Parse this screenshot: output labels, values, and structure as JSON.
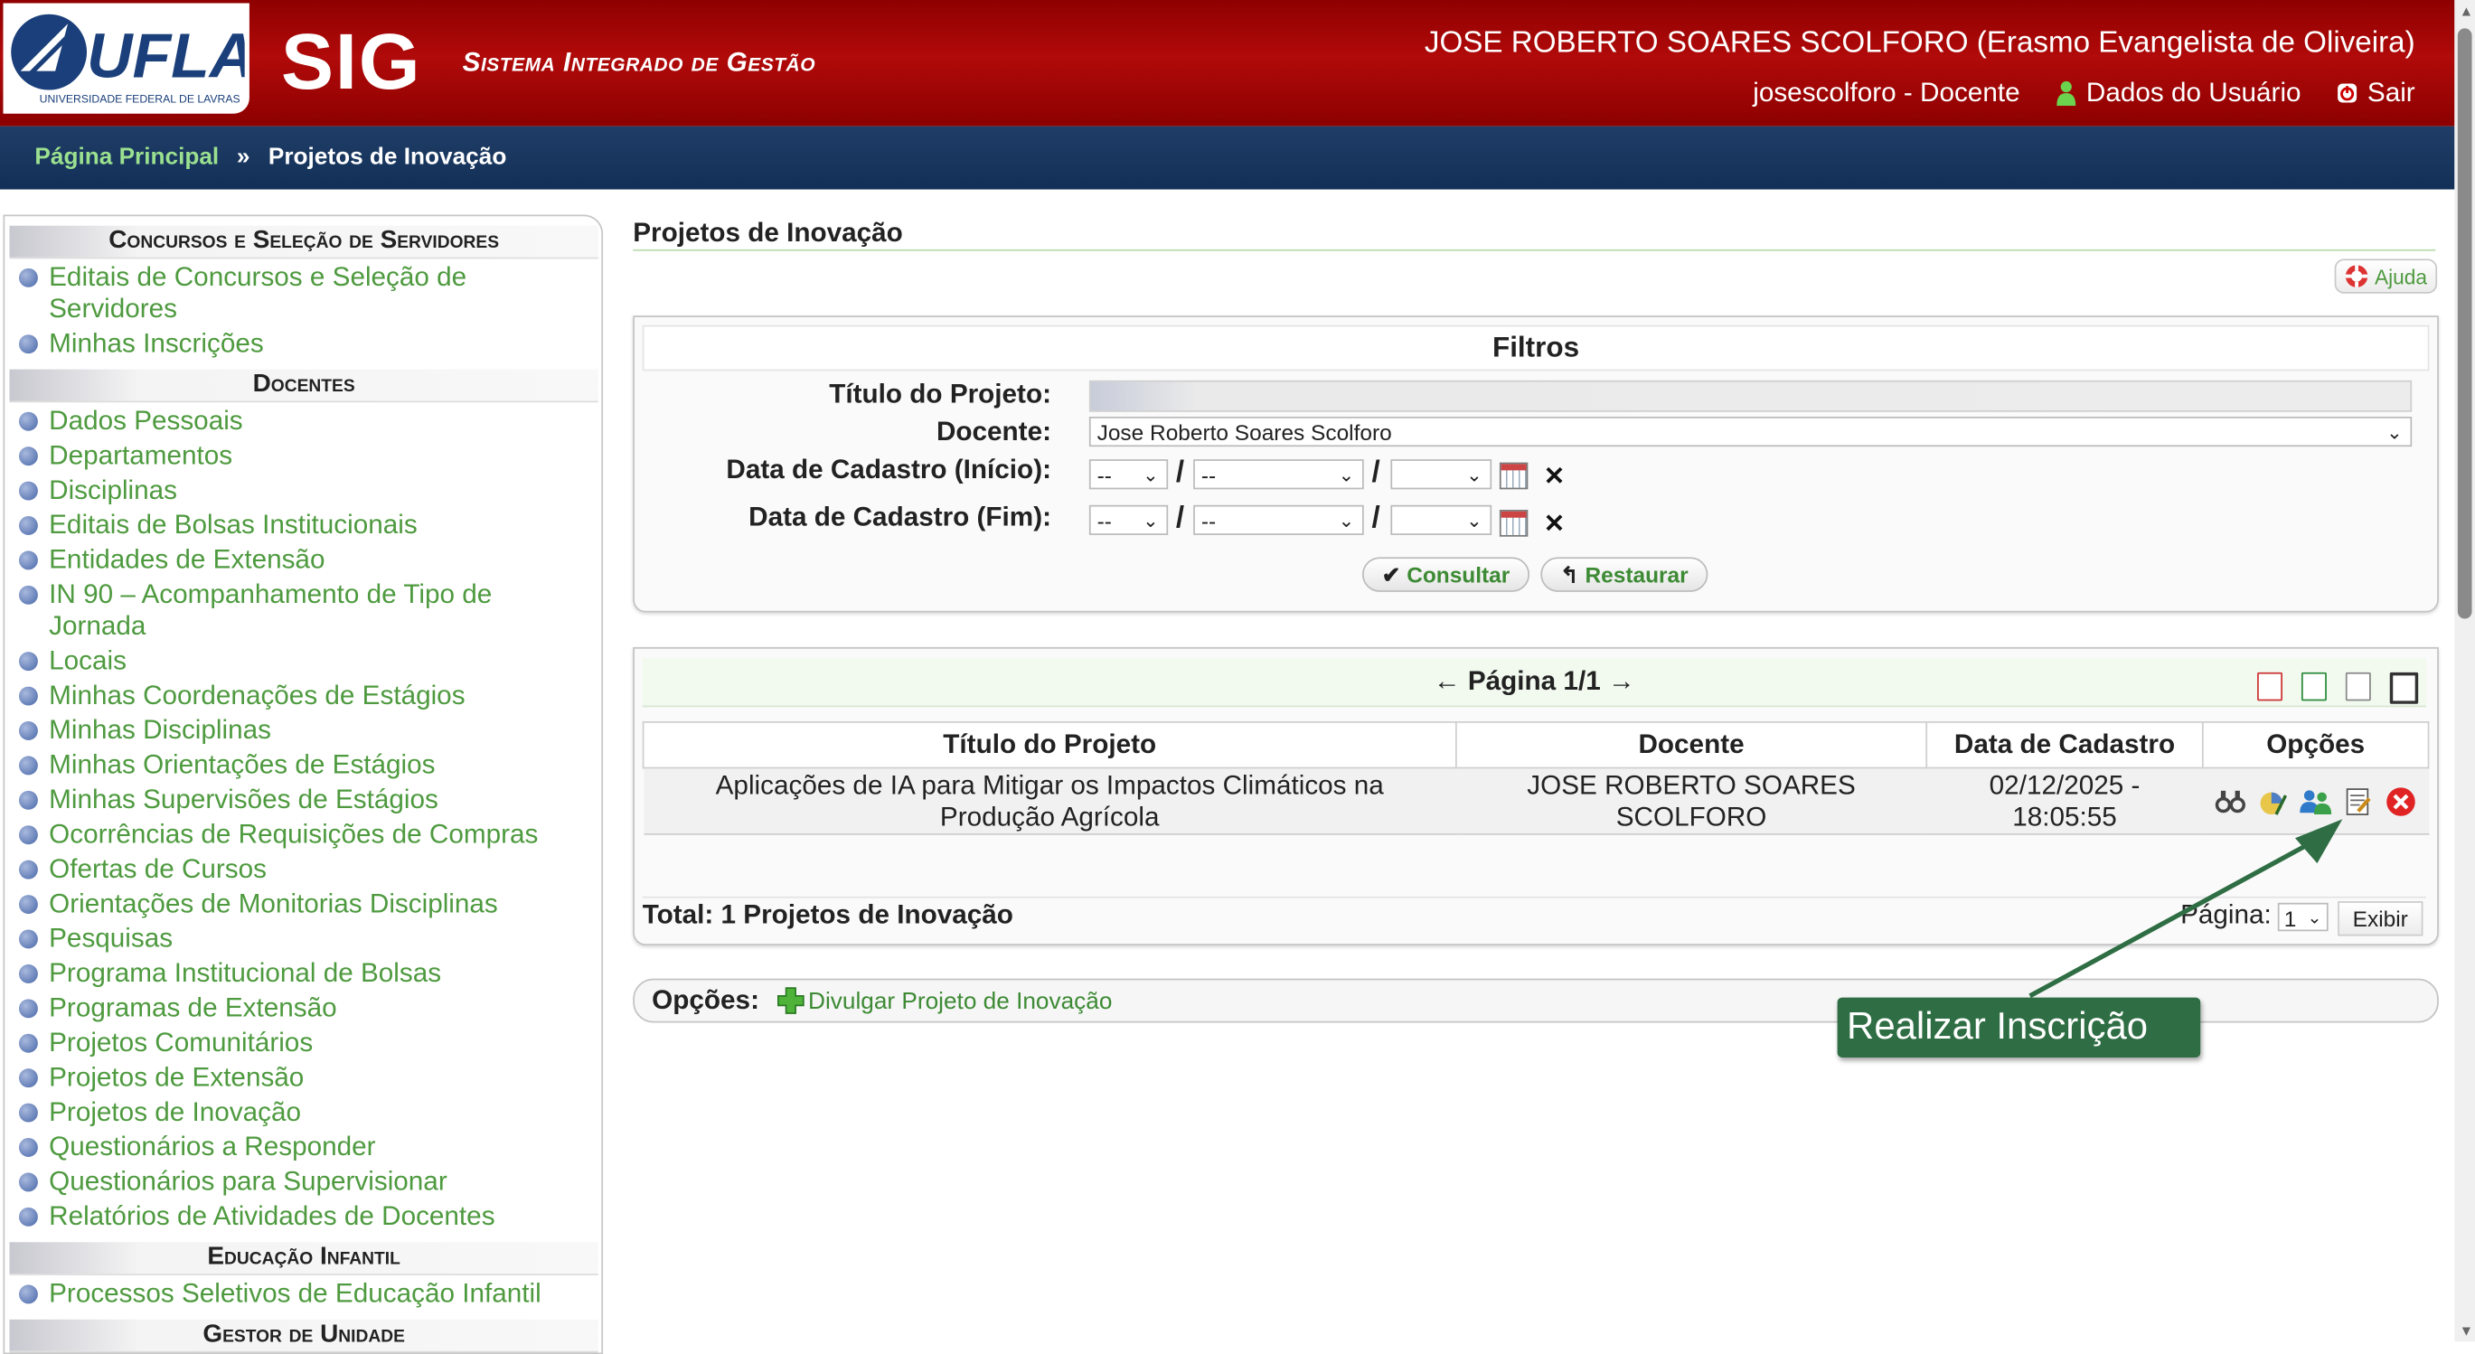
{
  "header": {
    "logo_text": "UFLA",
    "logo_caption": "UNIVERSIDADE FEDERAL DE LAVRAS",
    "system_short": "SIG",
    "system_name": "Sistema Integrado de Gestão",
    "user_full": "JOSE ROBERTO SOARES SCOLFORO (Erasmo Evangelista de Oliveira)",
    "user_login": "josescolforo - Docente",
    "user_data_link": "Dados do Usuário",
    "logout_link": "Sair"
  },
  "breadcrumb": {
    "home": "Página Principal",
    "separator": "»",
    "current": "Projetos de Inovação"
  },
  "sidebar": {
    "sections": [
      {
        "title": "Concursos e Seleção de Servidores",
        "items": [
          "Editais de Concursos e Seleção de Servidores",
          "Minhas Inscrições"
        ]
      },
      {
        "title": "Docentes",
        "items": [
          "Dados Pessoais",
          "Departamentos",
          "Disciplinas",
          "Editais de Bolsas Institucionais",
          "Entidades de Extensão",
          "IN 90 – Acompanhamento de Tipo de Jornada",
          "Locais",
          "Minhas Coordenações de Estágios",
          "Minhas Disciplinas",
          "Minhas Orientações de Estágios",
          "Minhas Supervisões de Estágios",
          "Ocorrências de Requisições de Compras",
          "Ofertas de Cursos",
          "Orientações de Monitorias Disciplinas",
          "Pesquisas",
          "Programa Institucional de Bolsas",
          "Programas de Extensão",
          "Projetos Comunitários",
          "Projetos de Extensão",
          "Projetos de Inovação",
          "Questionários a Responder",
          "Questionários para Supervisionar",
          "Relatórios de Atividades de Docentes"
        ]
      },
      {
        "title": "Educação Infantil",
        "items": [
          "Processos Seletivos de Educação Infantil"
        ]
      },
      {
        "title": "Gestor de Unidade",
        "items": []
      }
    ]
  },
  "main": {
    "title": "Projetos de Inovação",
    "help_label": "Ajuda",
    "filters": {
      "caption": "Filtros",
      "titulo_label": "Título do Projeto:",
      "titulo_value": "",
      "docente_label": "Docente:",
      "docente_value": "Jose Roberto Soares Scolforo",
      "inicio_label": "Data de Cadastro (Início):",
      "fim_label": "Data de Cadastro (Fim):",
      "day_placeholder": "--",
      "month_placeholder": "--",
      "year_placeholder": "",
      "date_separator": "/",
      "clear_glyph": "✕",
      "consultar": "Consultar",
      "restaurar": "Restaurar"
    },
    "results": {
      "pager": "Página 1/1",
      "prev_arrow": "←",
      "next_arrow": "→",
      "columns": [
        "Título do Projeto",
        "Docente",
        "Data de Cadastro",
        "Opções"
      ],
      "rows": [
        {
          "titulo": "Aplicações de IA para Mitigar os Impactos Climáticos na Produção Agrícola",
          "docente": "JOSE ROBERTO SOARES SCOLFORO",
          "data": "02/12/2025 - 18:05:55"
        }
      ],
      "total": "Total: 1 Projetos de Inovação",
      "page_label": "Página:",
      "page_value": "1",
      "exibir": "Exibir"
    },
    "options_label": "Opções:",
    "options_link": "Divulgar Projeto de Inovação",
    "tooltip": "Realizar Inscrição"
  },
  "colors": {
    "header_red": "#a00808",
    "crumb_blue": "#163560",
    "link_green": "#4e9a3f",
    "tooltip_green": "#2f6e44"
  }
}
